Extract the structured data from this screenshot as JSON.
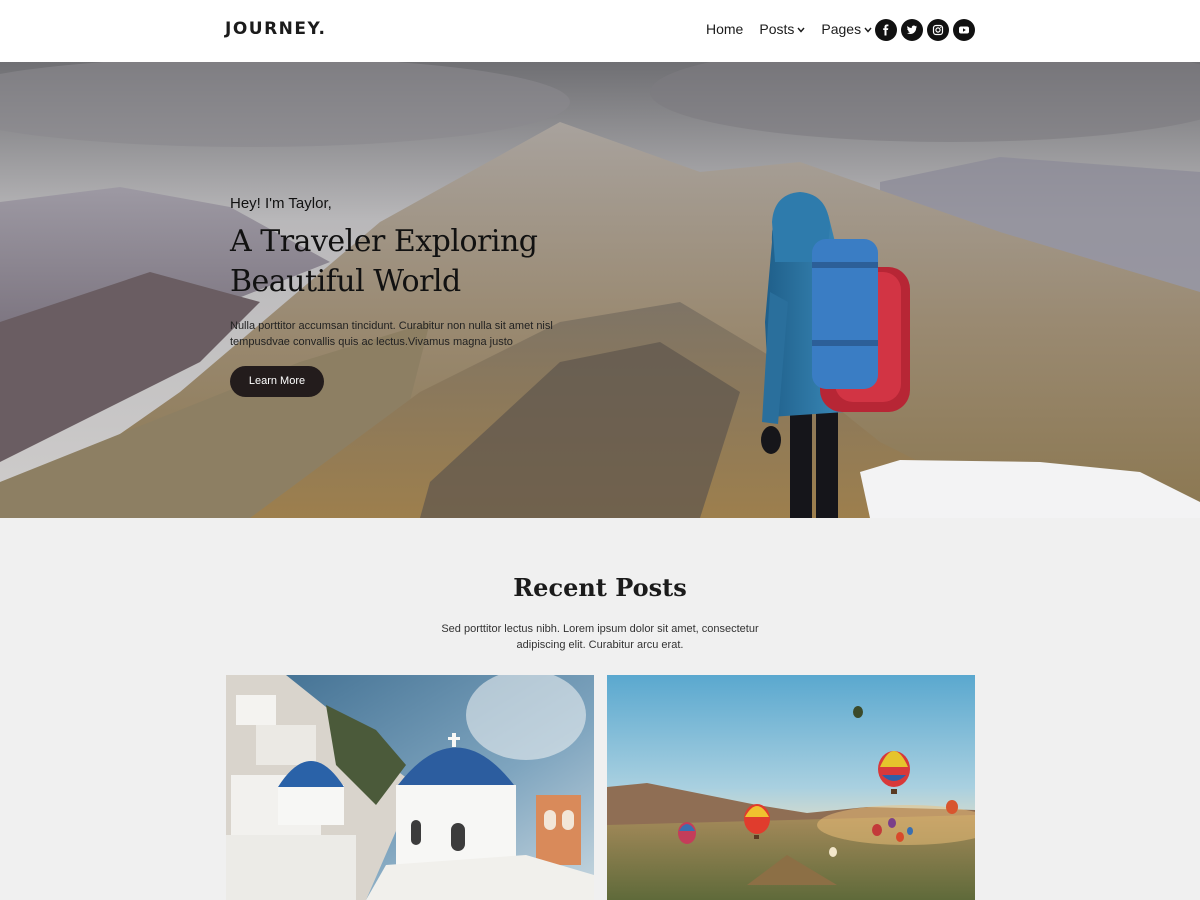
{
  "brand": {
    "logo": "JOURNEY."
  },
  "nav": {
    "items": [
      {
        "label": "Home"
      },
      {
        "label": "Posts"
      },
      {
        "label": "Pages"
      }
    ]
  },
  "social": [
    {
      "icon": "facebook-icon"
    },
    {
      "icon": "twitter-icon"
    },
    {
      "icon": "instagram-icon"
    },
    {
      "icon": "youtube-icon"
    }
  ],
  "hero": {
    "eyebrow": "Hey! I'm Taylor,",
    "title_line1": "A Traveler Exploring",
    "title_line2": "Beautiful World",
    "description": "Nulla porttitor accumsan tincidunt. Curabitur non nulla sit amet nisl tempusdvae convallis quis ac lectus.Vivamus magna justo",
    "button": "Learn More"
  },
  "recent": {
    "title": "Recent Posts",
    "subtitle": "Sed porttitor lectus nibh. Lorem ipsum dolor sit amet, consectetur adipiscing elit. Curabitur arcu erat.",
    "cards": [
      {
        "image": "santorini-photo"
      },
      {
        "image": "hot-air-balloons-photo"
      }
    ]
  },
  "colors": {
    "header_bg": "#ffffff",
    "section_bg": "#f0f0f0",
    "button_bg": "#231c1c",
    "text": "#1b1b1b"
  }
}
